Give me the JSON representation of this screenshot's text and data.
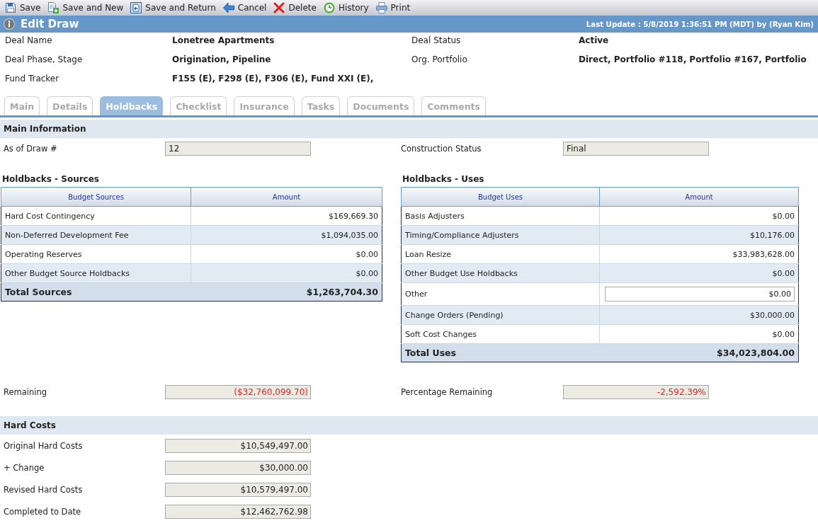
{
  "toolbar": {
    "buttons": [
      {
        "kind": "save",
        "label": "Save"
      },
      {
        "kind": "save-new",
        "label": "Save and New"
      },
      {
        "kind": "save-return",
        "label": "Save and Return"
      },
      {
        "kind": "cancel",
        "label": "Cancel"
      },
      {
        "kind": "delete",
        "label": "Delete"
      },
      {
        "kind": "history",
        "label": "History"
      },
      {
        "kind": "print",
        "label": "Print"
      }
    ]
  },
  "header": {
    "title": "Edit Draw",
    "last_update": "Last Update : 5/8/2019 1:36:51 PM (MDT) by (Ryan Kim)"
  },
  "deal_info": [
    {
      "label": "Deal Name",
      "value": "Lonetree Apartments"
    },
    {
      "label": "Deal Status",
      "value": "Active"
    },
    {
      "label": "Deal Phase, Stage",
      "value": "Origination, Pipeline"
    },
    {
      "label": "Org. Portfolio",
      "value": "Direct, Portfolio #118, Portfolio #167, Portfolio"
    },
    {
      "label": "Fund Tracker",
      "value": "F155 (E), F298 (E), F306 (E), Fund XXI (E),"
    }
  ],
  "tabs": [
    {
      "label": "Main",
      "selected": false
    },
    {
      "label": "Details",
      "selected": false
    },
    {
      "label": "Holdbacks",
      "selected": true
    },
    {
      "label": "Checklist",
      "selected": false
    },
    {
      "label": "Insurance",
      "selected": false
    },
    {
      "label": "Tasks",
      "selected": false
    },
    {
      "label": "Documents",
      "selected": false
    },
    {
      "label": "Comments",
      "selected": false
    }
  ],
  "main_information": {
    "title": "Main Information",
    "fields": [
      {
        "label": "As of Draw #",
        "value": "12"
      },
      {
        "label": "Construction Status",
        "value": "Final"
      }
    ]
  },
  "sources": {
    "title": "Holdbacks - Sources",
    "columns": [
      "Budget Sources",
      "Amount"
    ],
    "rows": [
      {
        "kind": "text",
        "name": "Hard Cost Contingency",
        "amount": "$169,669.30"
      },
      {
        "kind": "text",
        "name": "Non-Deferred Development Fee",
        "amount": "$1,094,035.00"
      },
      {
        "kind": "text",
        "name": "Operating Reserves",
        "amount": "$0.00"
      },
      {
        "kind": "text",
        "name": "Other Budget Source Holdbacks",
        "amount": "$0.00"
      }
    ],
    "total": {
      "label": "Total Sources",
      "amount": "$1,263,704.30"
    }
  },
  "uses": {
    "title": "Holdbacks - Uses",
    "columns": [
      "Budget Uses",
      "Amount"
    ],
    "rows": [
      {
        "kind": "text",
        "name": "Basis Adjusters",
        "amount": "$0.00"
      },
      {
        "kind": "text",
        "name": "Timing/Compliance Adjusters",
        "amount": "$10,176.00"
      },
      {
        "kind": "text",
        "name": "Loan Resize",
        "amount": "$33,983,628.00"
      },
      {
        "kind": "text",
        "name": "Other Budget Use Holdbacks",
        "amount": "$0.00"
      },
      {
        "kind": "input",
        "name": "Other",
        "amount": "$0.00"
      },
      {
        "kind": "text",
        "name": "Change Orders (Pending)",
        "amount": "$30,000.00"
      },
      {
        "kind": "text",
        "name": "Soft Cost Changes",
        "amount": "$0.00"
      }
    ],
    "total": {
      "label": "Total Uses",
      "amount": "$34,023,804.00"
    }
  },
  "remaining": {
    "fields": [
      {
        "label": "Remaining",
        "value": "($32,760,099.70)",
        "negative": true
      },
      {
        "label": "Percentage Remaining",
        "value": "-2,592.39%",
        "negative": true
      }
    ]
  },
  "hard_costs": {
    "title": "Hard Costs",
    "fields": [
      {
        "label": "Original Hard Costs",
        "value": "$10,549,497.00",
        "negative": false
      },
      {
        "label": "+ Change",
        "value": "$30,000.00",
        "negative": false
      },
      {
        "label": "Revised Hard Costs",
        "value": "$10,579,497.00",
        "negative": false
      },
      {
        "label": "Completed to Date",
        "value": "$12,462,762.98",
        "negative": false
      }
    ]
  }
}
